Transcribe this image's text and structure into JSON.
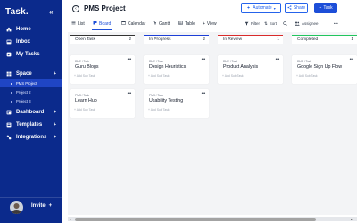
{
  "sidebar": {
    "logo": "Task.",
    "items": [
      {
        "label": "Home"
      },
      {
        "label": "Inbox"
      },
      {
        "label": "My Tasks"
      }
    ],
    "space": {
      "label": "Space",
      "add": "+"
    },
    "projects": [
      {
        "label": "PMS Project",
        "active": true
      },
      {
        "label": "Project 2"
      },
      {
        "label": "Project 3"
      }
    ],
    "sections": [
      {
        "label": "Dashboard",
        "add": "+"
      },
      {
        "label": "Templates",
        "add": "+"
      },
      {
        "label": "Integrations",
        "add": "+"
      }
    ],
    "invite": {
      "label": "Invite",
      "add": "+"
    }
  },
  "header": {
    "title": "PMS Project",
    "automate": "Automate",
    "share": "Share",
    "task": "Task"
  },
  "views": [
    {
      "label": "List"
    },
    {
      "label": "Board"
    },
    {
      "label": "Calendar"
    },
    {
      "label": "Gantt"
    },
    {
      "label": "Table"
    },
    {
      "label": "View"
    }
  ],
  "tools": {
    "filter": "Filter",
    "sort": "Sort",
    "assignee": "Assignee"
  },
  "board": {
    "columns": [
      {
        "name": "Open Task",
        "count": "2",
        "color": "#333333",
        "cards": [
          {
            "crumb": "PMS / Task",
            "title": "Guru Blogs",
            "sub": "+ Add Sub Task"
          },
          {
            "crumb": "PMS / Task",
            "title": "Learn Hub",
            "sub": "+ Add Sub Task"
          }
        ]
      },
      {
        "name": "In Progress",
        "count": "2",
        "color": "#1d3fd6",
        "cards": [
          {
            "crumb": "PMS / Task",
            "title": "Design Heuristics",
            "sub": "+ Add Sub Task"
          },
          {
            "crumb": "PMS / Task",
            "title": "Usability Testing",
            "sub": "+ Add Sub Task"
          }
        ]
      },
      {
        "name": "In Review",
        "count": "1",
        "color": "#d92b2b",
        "cards": [
          {
            "crumb": "PMS / Task",
            "title": "Product Analysis",
            "sub": "+ Add Sub Task"
          }
        ]
      },
      {
        "name": "Completed",
        "count": "1",
        "color": "#22c55e",
        "cards": [
          {
            "crumb": "PMS / Task",
            "title": "Google Sign Up Flow",
            "sub": "+ Add Sub Task"
          }
        ]
      }
    ]
  }
}
